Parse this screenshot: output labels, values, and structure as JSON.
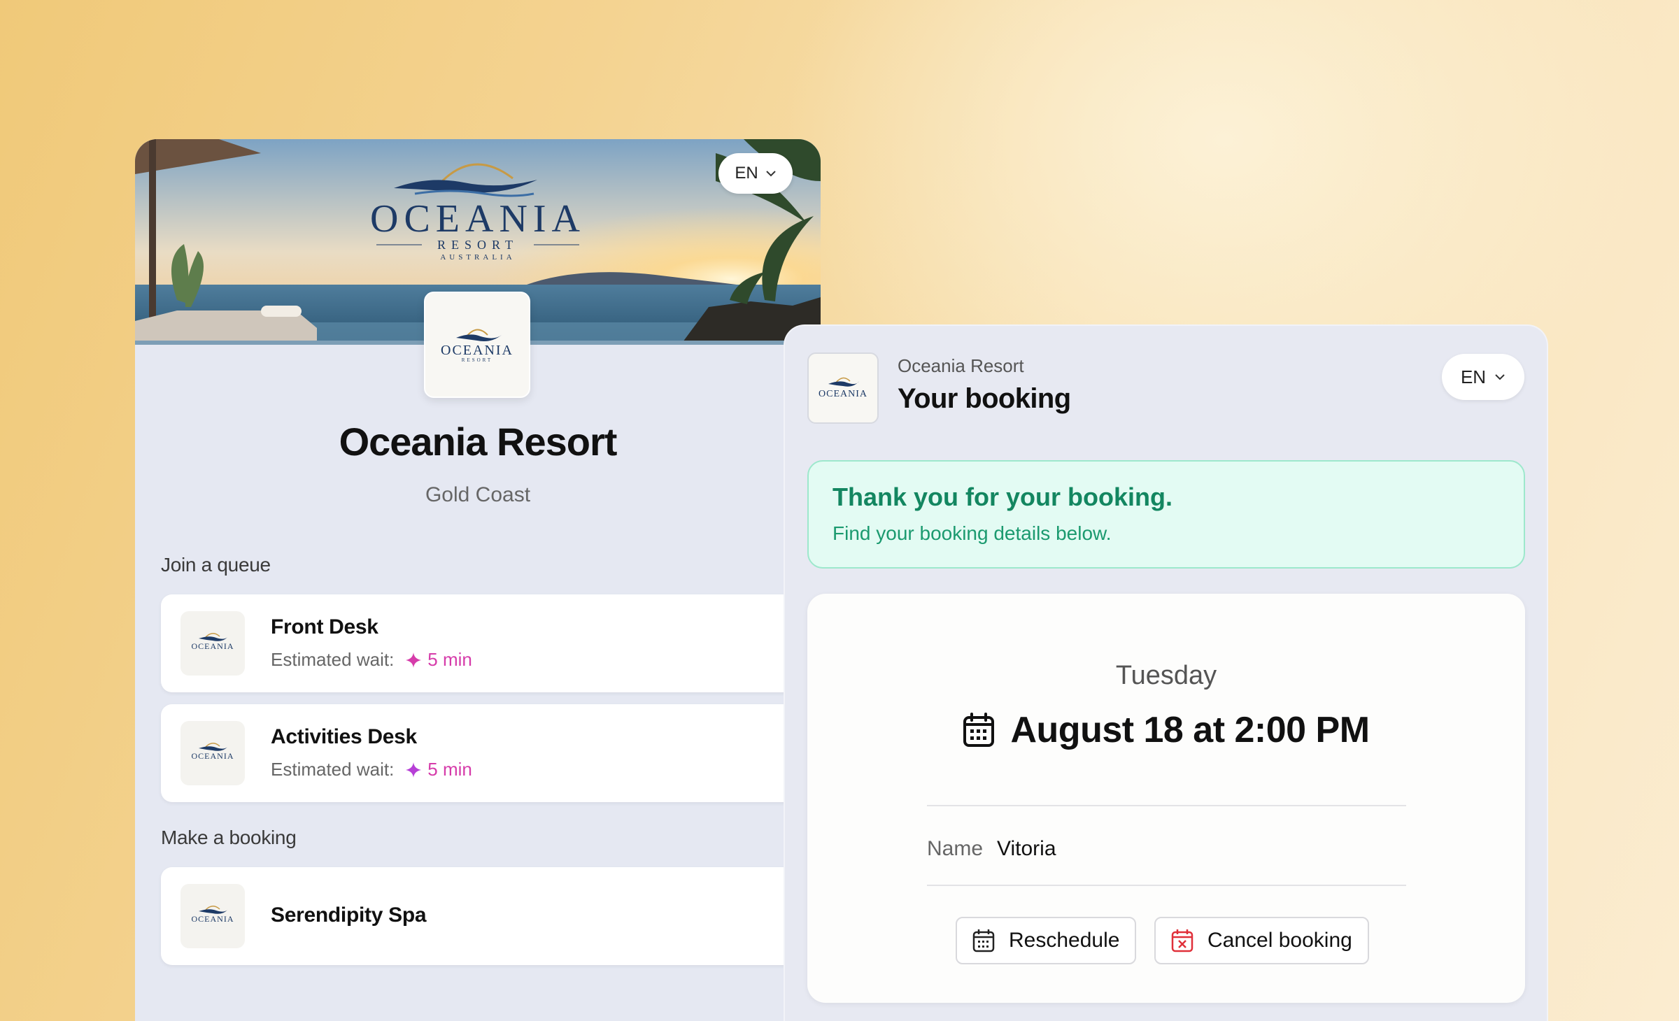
{
  "left": {
    "hero_brand": "OCEANIA",
    "hero_brand_sub": "RESORT",
    "hero_brand_country": "AUSTRALIA",
    "lang": "EN",
    "venue_name": "Oceania Resort",
    "venue_location": "Gold Coast",
    "queue_section": "Join a queue",
    "queues": [
      {
        "name": "Front Desk",
        "wait_label": "Estimated wait:",
        "wait_value": "5 min"
      },
      {
        "name": "Activities Desk",
        "wait_label": "Estimated wait:",
        "wait_value": "5 min"
      }
    ],
    "booking_section": "Make a booking",
    "bookings": [
      {
        "name": "Serendipity Spa"
      }
    ]
  },
  "right": {
    "venue": "Oceania Resort",
    "title": "Your booking",
    "lang": "EN",
    "success_title": "Thank you for your booking.",
    "success_body": "Find your booking details below.",
    "day": "Tuesday",
    "datetime": "August 18 at 2:00 PM",
    "name_label": "Name",
    "name_value": "Vitoria",
    "reschedule_label": "Reschedule",
    "cancel_label": "Cancel booking"
  },
  "colors": {
    "success_text": "#138660",
    "wait_accent": "#d63caa",
    "cancel_icon": "#e0303a"
  }
}
